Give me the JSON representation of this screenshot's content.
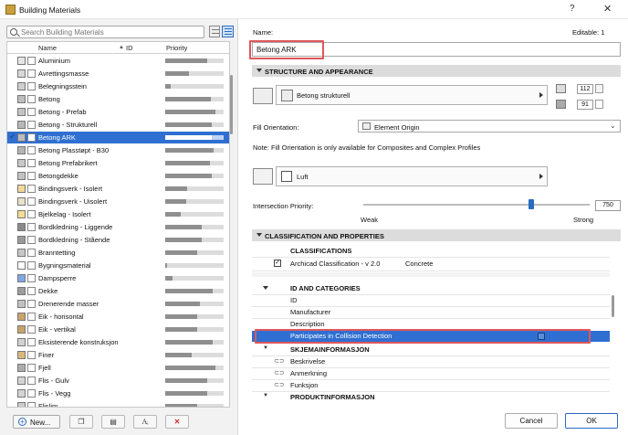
{
  "window": {
    "title": "Building Materials",
    "help": "?",
    "close": "✕"
  },
  "search": {
    "placeholder": "Search Building Materials"
  },
  "list": {
    "headers": {
      "name": "Name",
      "id": "ID",
      "priority": "Priority"
    },
    "rows": [
      {
        "name": "Aluminium",
        "priority": 0.72,
        "swatch": "#e6e6e6",
        "check": false
      },
      {
        "name": "Avrettingsmasse",
        "priority": 0.4,
        "swatch": "#d8d8d8",
        "check": false
      },
      {
        "name": "Belegningsstein",
        "priority": 0.1,
        "swatch": "#cfcfcf",
        "check": false
      },
      {
        "name": "Betong",
        "priority": 0.78,
        "swatch": "#bdbdbd",
        "check": false
      },
      {
        "name": "Betong - Prefab",
        "priority": 0.86,
        "swatch": "#c4c4c4",
        "check": false
      },
      {
        "name": "Betong - Strukturell",
        "priority": 0.8,
        "swatch": "#b8b8b8",
        "check": false
      },
      {
        "name": "Betong ARK",
        "priority": 0.8,
        "swatch": "#bcbcbc",
        "check": true,
        "selected": true
      },
      {
        "name": "Betong Plasstøpt - B30",
        "priority": 0.83,
        "swatch": "#b4b4b4",
        "check": false
      },
      {
        "name": "Betong Prefabrikert",
        "priority": 0.76,
        "swatch": "#c8c8c8",
        "check": false
      },
      {
        "name": "Betongdekke",
        "priority": 0.79,
        "swatch": "#c2c2c2",
        "check": false
      },
      {
        "name": "Bindingsverk - Isolert",
        "priority": 0.38,
        "swatch": "#f1d79a",
        "check": false
      },
      {
        "name": "Bindingsverk - Uisolert",
        "priority": 0.36,
        "swatch": "#e9e0c9",
        "check": false
      },
      {
        "name": "Bjelkelag - Isolert",
        "priority": 0.26,
        "swatch": "#f4dd92",
        "check": false
      },
      {
        "name": "Bordkledning - Liggende",
        "priority": 0.63,
        "swatch": "#8a8a8a",
        "check": false
      },
      {
        "name": "Bordkledning - Stående",
        "priority": 0.63,
        "swatch": "#9a9a9a",
        "check": false
      },
      {
        "name": "Branntetting",
        "priority": 0.55,
        "swatch": "#c6c6c6",
        "check": false
      },
      {
        "name": "Bygningsmaterial",
        "priority": 0.03,
        "swatch": "#ffffff",
        "check": false
      },
      {
        "name": "Dampsperre",
        "priority": 0.12,
        "swatch": "#7ea7e6",
        "check": false
      },
      {
        "name": "Dekke",
        "priority": 0.81,
        "swatch": "#9d9d9d",
        "check": false
      },
      {
        "name": "Drenerende masser",
        "priority": 0.6,
        "swatch": "#c2c2c2",
        "check": false
      },
      {
        "name": "Eik - horisontal",
        "priority": 0.54,
        "swatch": "#c9a36a",
        "check": false
      },
      {
        "name": "Eik - vertikal",
        "priority": 0.54,
        "swatch": "#c9a36a",
        "check": false
      },
      {
        "name": "Eksisterende konstruksjon",
        "priority": 0.82,
        "swatch": "#d2d2d2",
        "check": false
      },
      {
        "name": "Finer",
        "priority": 0.45,
        "swatch": "#d9b979",
        "check": false
      },
      {
        "name": "Fjell",
        "priority": 0.86,
        "swatch": "#adadad",
        "check": false
      },
      {
        "name": "Flis - Gulv",
        "priority": 0.72,
        "swatch": "#d4d4d4",
        "check": false
      },
      {
        "name": "Flis - Vegg",
        "priority": 0.72,
        "swatch": "#d4d4d4",
        "check": false
      },
      {
        "name": "Flislim",
        "priority": 0.55,
        "swatch": "#cdcdcd",
        "check": false
      }
    ]
  },
  "bottom_left": {
    "new_label": "New..."
  },
  "name": {
    "label": "Name:",
    "value": "Betong ARK",
    "editable": "Editable: 1"
  },
  "structure": {
    "header": "STRUCTURE AND APPEARANCE",
    "fill_name": "Betong strukturell",
    "pen1": "112",
    "pen2": "91",
    "fill_orientation_label": "Fill Orientation:",
    "fill_orientation_value": "Element Origin",
    "note": "Note: Fill Orientation is only available for Composites and Complex Profiles",
    "surface_name": "Luft",
    "intersection_label": "Intersection Priority:",
    "intersection_value": "750",
    "intersection_fraction": 0.74,
    "weak": "Weak",
    "strong": "Strong"
  },
  "classification": {
    "header": "CLASSIFICATION AND PROPERTIES",
    "classifications_label": "CLASSIFICATIONS",
    "system": "Archicad Classification - v 2.0",
    "system_value": "Concrete",
    "id_categories": "ID AND CATEGORIES",
    "props": [
      "ID",
      "Manufacturer",
      "Description",
      "Participates in Collision Detection"
    ],
    "skjema": "SKJEMAINFORMASJON",
    "skjema_props": [
      "Beskrivelse",
      "Anmerkning",
      "Funksjon"
    ],
    "produkt": "PRODUKTINFORMASJON"
  },
  "buttons": {
    "cancel": "Cancel",
    "ok": "OK"
  },
  "colors": {
    "accent": "#2f6fd1",
    "highlight": "#e0565b",
    "section": "#dcdcdc"
  }
}
